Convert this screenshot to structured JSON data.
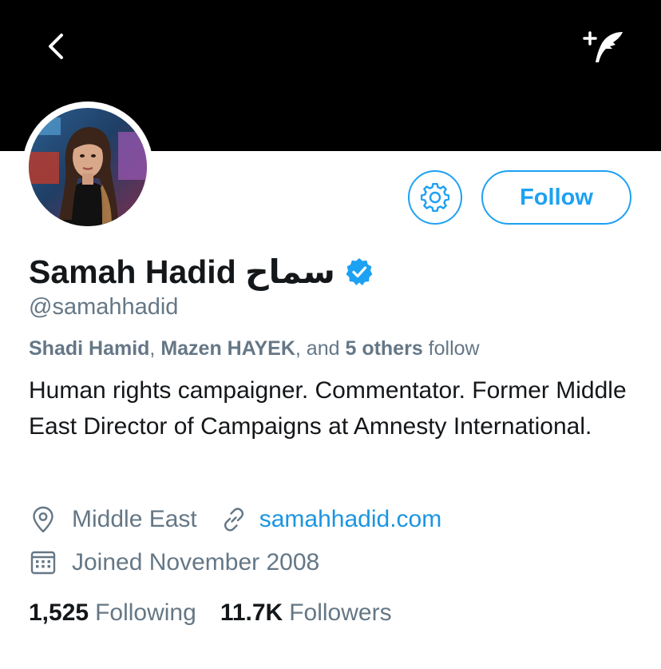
{
  "header": {
    "back_icon": "chevron-left-icon",
    "compose_icon": "compose-tweet-feather-icon"
  },
  "profile": {
    "name": "Samah Hadid سماح",
    "verified": true,
    "handle": "@samahhadid",
    "follow_label": "Follow",
    "settings_icon": "gear-icon",
    "followed_by": {
      "user1": "Shadi Hamid",
      "sep1": ", ",
      "user2": "Mazen HAYEK",
      "sep2": ", and ",
      "others": "5 others",
      "suffix": " follow"
    },
    "bio": "Human rights campaigner. Commentator. Former Middle East Director of Campaigns at Amnesty International.",
    "location": "Middle East",
    "website": "samahhadid.com",
    "joined": "Joined November 2008",
    "stats": {
      "following_count": "1,525",
      "following_label": "Following",
      "followers_count": "11.7K",
      "followers_label": "Followers"
    }
  },
  "colors": {
    "accent": "#1da1f2",
    "link": "#1b95e0",
    "muted": "#657786",
    "text": "#14171a",
    "header_bg": "#000000"
  }
}
